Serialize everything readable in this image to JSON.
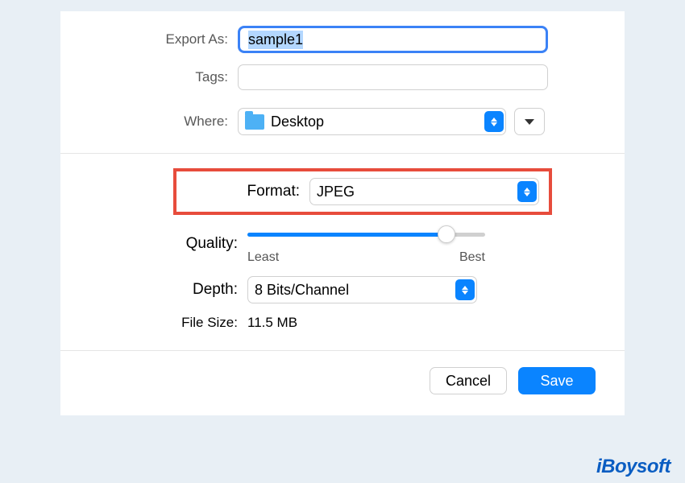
{
  "labels": {
    "export_as": "Export As:",
    "tags": "Tags:",
    "where": "Where:",
    "format": "Format:",
    "quality": "Quality:",
    "depth": "Depth:",
    "file_size": "File Size:"
  },
  "fields": {
    "filename": "sample1",
    "where_value": "Desktop",
    "format_value": "JPEG",
    "depth_value": "8 Bits/Channel",
    "file_size_value": "11.5 MB"
  },
  "quality": {
    "min_label": "Least",
    "max_label": "Best",
    "percent": 82
  },
  "buttons": {
    "cancel": "Cancel",
    "save": "Save"
  },
  "watermark": "iBoysoft"
}
